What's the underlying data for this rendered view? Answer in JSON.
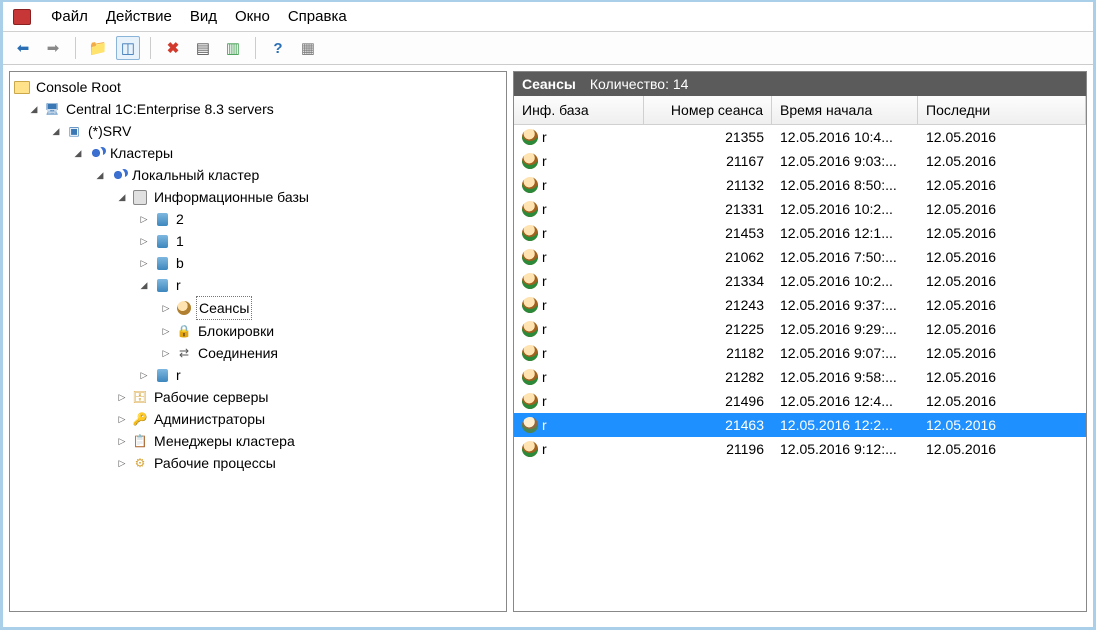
{
  "menu": {
    "file": "Файл",
    "action": "Действие",
    "view": "Вид",
    "window": "Окно",
    "help": "Справка"
  },
  "tree": {
    "root": "Console Root",
    "central": "Central 1C:Enterprise 8.3 servers",
    "srv": "(*)SRV",
    "clusters": "Кластеры",
    "local_cluster": "Локальный кластер",
    "infobases": "Информационные базы",
    "db2": "2",
    "db1": "1",
    "dbb": "b",
    "dbr": "r",
    "sessions": "Сеансы",
    "locks": "Блокировки",
    "connections": "Соединения",
    "dbr2": "r",
    "work_servers": "Рабочие серверы",
    "admins": "Администраторы",
    "managers": "Менеджеры кластера",
    "work_proc": "Рабочие процессы"
  },
  "grid": {
    "title": "Сеансы",
    "count_label": "Количество: 14",
    "columns": {
      "infobase": "Инф. база",
      "session_no": "Номер сеанса",
      "start_time": "Время начала",
      "last": "Последни"
    },
    "rows": [
      {
        "ib": "r",
        "n": "21355",
        "st": "12.05.2016 10:4...",
        "la": "12.05.2016"
      },
      {
        "ib": "r",
        "n": "21167",
        "st": "12.05.2016 9:03:...",
        "la": "12.05.2016"
      },
      {
        "ib": "r",
        "n": "21132",
        "st": "12.05.2016 8:50:...",
        "la": "12.05.2016"
      },
      {
        "ib": "r",
        "n": "21331",
        "st": "12.05.2016 10:2...",
        "la": "12.05.2016"
      },
      {
        "ib": "r",
        "n": "21453",
        "st": "12.05.2016 12:1...",
        "la": "12.05.2016"
      },
      {
        "ib": "r",
        "n": "21062",
        "st": "12.05.2016 7:50:...",
        "la": "12.05.2016"
      },
      {
        "ib": "r",
        "n": "21334",
        "st": "12.05.2016 10:2...",
        "la": "12.05.2016"
      },
      {
        "ib": "r",
        "n": "21243",
        "st": "12.05.2016 9:37:...",
        "la": "12.05.2016"
      },
      {
        "ib": "r",
        "n": "21225",
        "st": "12.05.2016 9:29:...",
        "la": "12.05.2016"
      },
      {
        "ib": "r",
        "n": "21182",
        "st": "12.05.2016 9:07:...",
        "la": "12.05.2016"
      },
      {
        "ib": "r",
        "n": "21282",
        "st": "12.05.2016 9:58:...",
        "la": "12.05.2016"
      },
      {
        "ib": "r",
        "n": "21496",
        "st": "12.05.2016 12:4...",
        "la": "12.05.2016"
      },
      {
        "ib": "r",
        "n": "21463",
        "st": "12.05.2016 12:2...",
        "la": "12.05.2016",
        "selected": true
      },
      {
        "ib": "r",
        "n": "21196",
        "st": "12.05.2016 9:12:...",
        "la": "12.05.2016"
      }
    ]
  }
}
